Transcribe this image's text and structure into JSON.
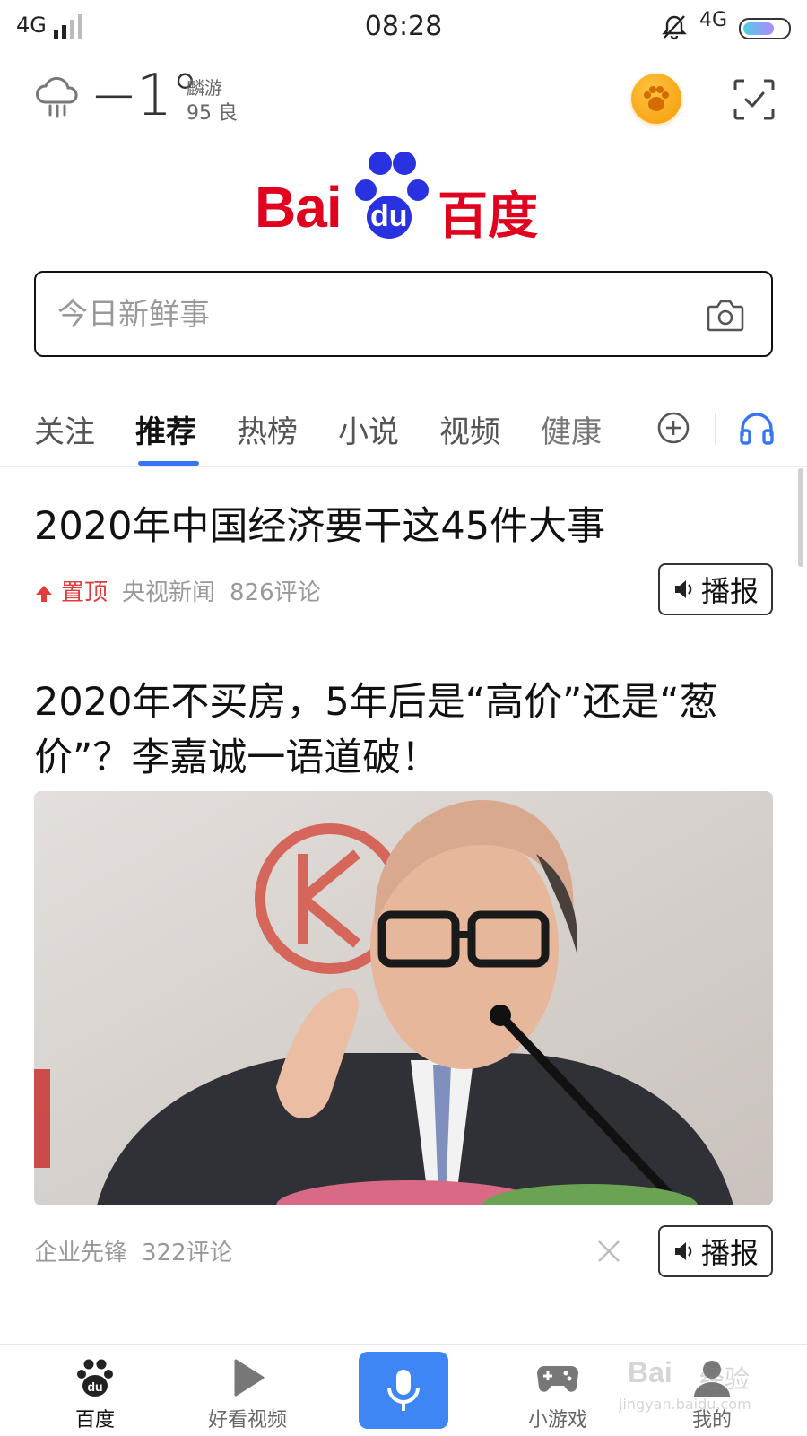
{
  "status_bar": {
    "network_left": "4G",
    "time": "08:28",
    "network_right": "4G"
  },
  "weather": {
    "temperature": "−1°",
    "location": "麟游",
    "aqi_value": "95",
    "aqi_level": "良",
    "icon": "rain-cloud-icon"
  },
  "brand": {
    "logo_text_bai": "Bai",
    "logo_text_du": "du",
    "logo_text_cn": "百度",
    "colors": {
      "red": "#e1001e",
      "blue": "#2932e1"
    }
  },
  "search": {
    "placeholder": "今日新鲜事"
  },
  "tabs": [
    {
      "label": "关注",
      "active": false
    },
    {
      "label": "推荐",
      "active": true
    },
    {
      "label": "热榜",
      "active": false
    },
    {
      "label": "小说",
      "active": false
    },
    {
      "label": "视频",
      "active": false
    },
    {
      "label": "健康",
      "active": false
    }
  ],
  "accent": "#3874f6",
  "feed": [
    {
      "title": "2020年中国经济要干这45件大事",
      "pin_label": "置顶",
      "source": "央视新闻",
      "comments": "826评论",
      "play_label": "播报"
    },
    {
      "title": "2020年不买房，5年后是“高价”还是“葱价”？李嘉诚一语道破！",
      "source": "企业先锋",
      "comments": "322评论",
      "play_label": "播报"
    }
  ],
  "bottom_nav": [
    {
      "label": "百度",
      "icon": "baidu-paw-icon",
      "active": true
    },
    {
      "label": "好看视频",
      "icon": "play-icon",
      "active": false
    },
    {
      "label": "",
      "icon": "microphone-icon",
      "active": false
    },
    {
      "label": "小游戏",
      "icon": "gamepad-icon",
      "active": false
    },
    {
      "label": "我的",
      "icon": "user-icon",
      "active": false
    }
  ],
  "watermark": {
    "line1": "Bai",
    "line1_b": "经验",
    "line2": "jingyan.baidu.com"
  }
}
